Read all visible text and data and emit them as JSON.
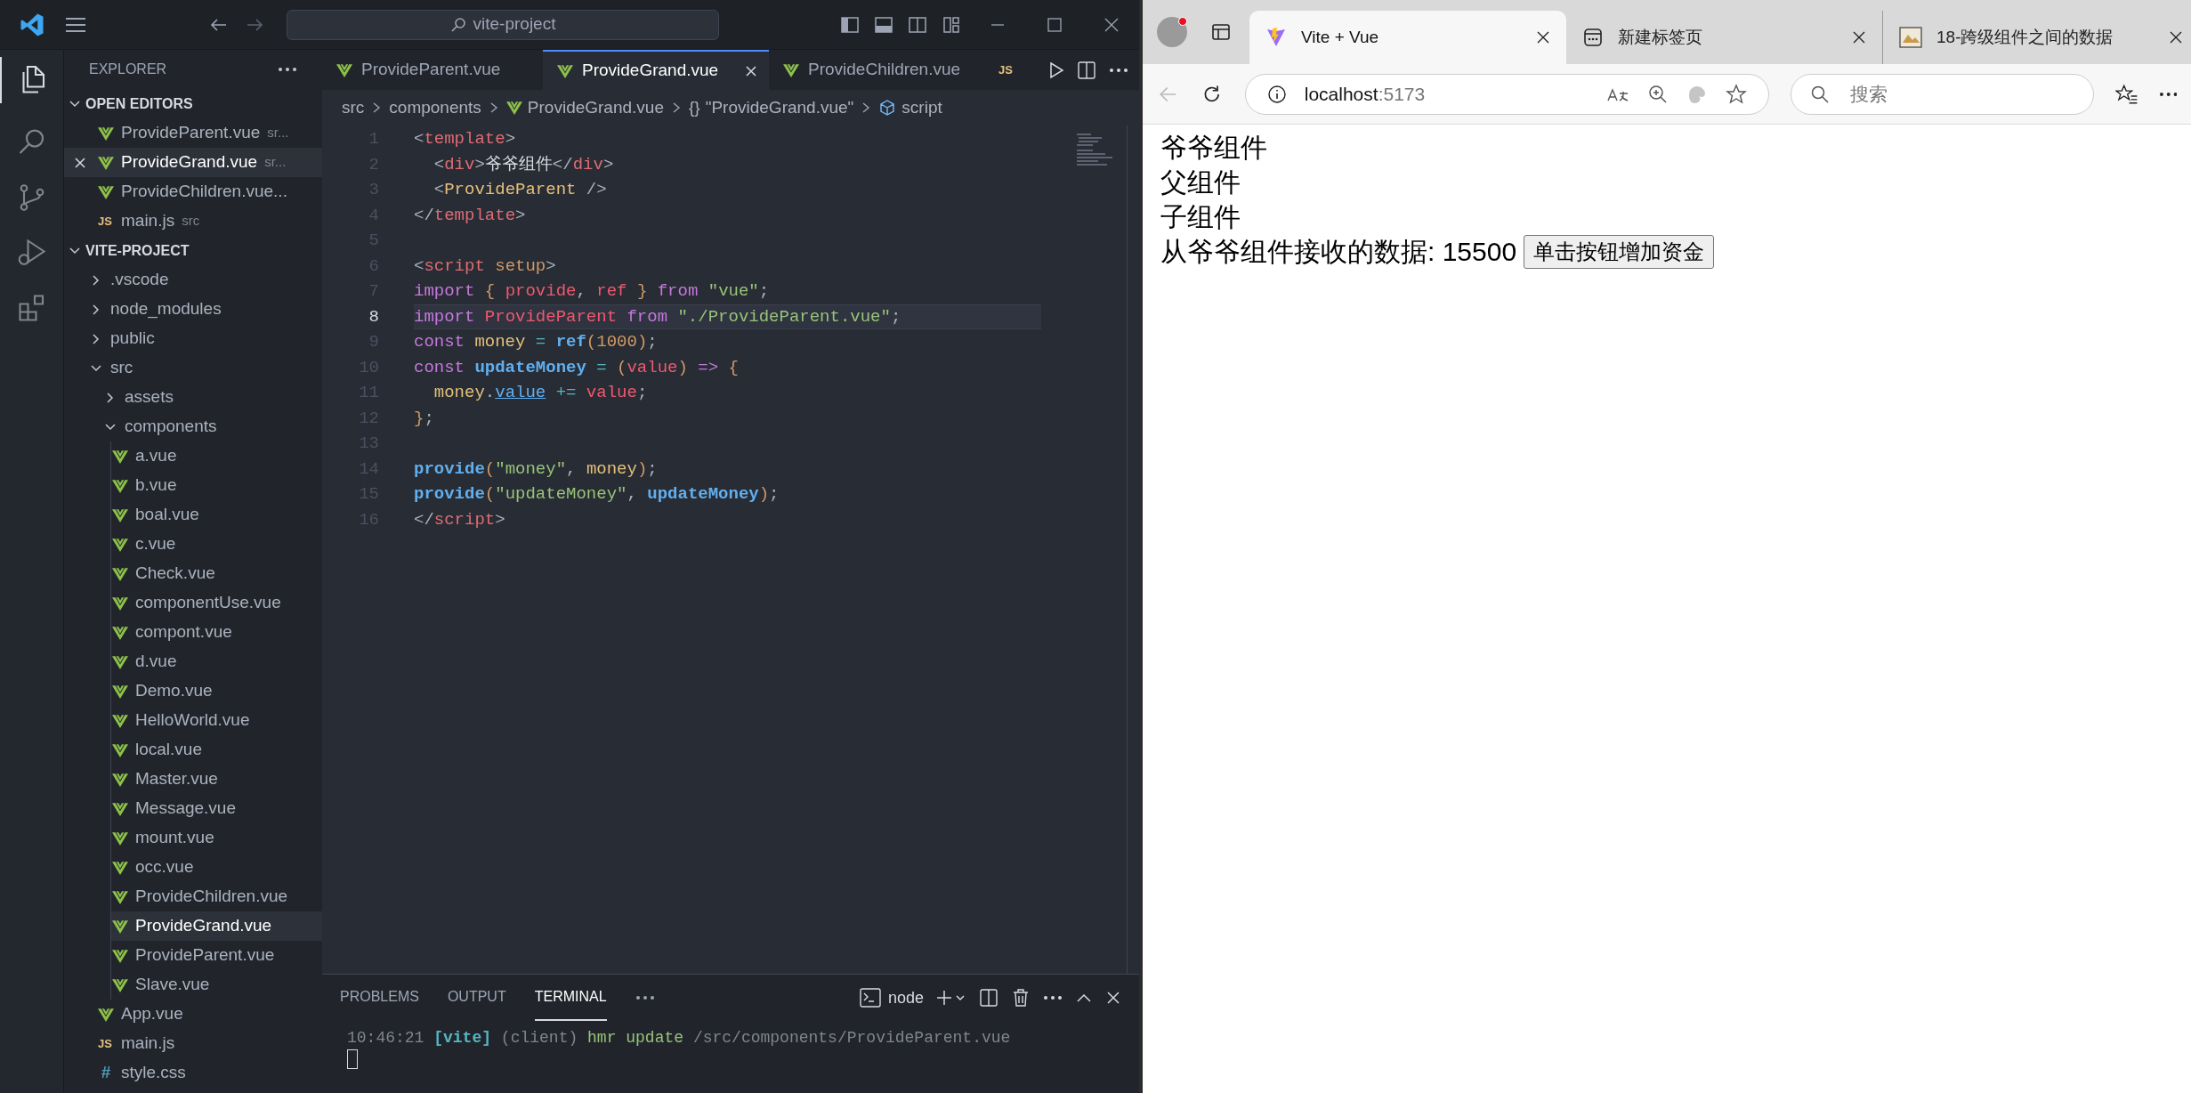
{
  "editor_window": {
    "command_center": "vite-project",
    "explorer": {
      "title": "EXPLORER",
      "open_editors": {
        "title": "OPEN EDITORS",
        "expanded": true,
        "items": [
          {
            "name": "ProvideParent.vue",
            "description": "sr...",
            "kind": "vue",
            "selected": false
          },
          {
            "name": "ProvideGrand.vue",
            "description": "sr...",
            "kind": "vue",
            "selected": true
          },
          {
            "name": "ProvideChildren.vue...",
            "kind": "vue",
            "selected": false
          },
          {
            "name": "main.js",
            "description": "src",
            "kind": "js",
            "icon": "JS",
            "selected": false
          }
        ]
      },
      "project": {
        "title": "VITE-PROJECT",
        "expanded": true,
        "items": [
          {
            "name": ".vscode",
            "kind": "folder",
            "expanded": false
          },
          {
            "name": "node_modules",
            "kind": "folder",
            "expanded": false
          },
          {
            "name": "public",
            "kind": "folder",
            "expanded": false
          },
          {
            "name": "src",
            "kind": "folder",
            "expanded": true,
            "children": [
              {
                "name": "assets",
                "kind": "folder",
                "expanded": false
              },
              {
                "name": "components",
                "kind": "folder",
                "expanded": true,
                "children": [
                  {
                    "name": "a.vue",
                    "kind": "vue",
                    "selected": false
                  },
                  {
                    "name": "b.vue",
                    "kind": "vue",
                    "selected": false
                  },
                  {
                    "name": "boal.vue",
                    "kind": "vue",
                    "selected": false
                  },
                  {
                    "name": "c.vue",
                    "kind": "vue",
                    "selected": false
                  },
                  {
                    "name": "Check.vue",
                    "kind": "vue",
                    "selected": false
                  },
                  {
                    "name": "componentUse.vue",
                    "kind": "vue",
                    "selected": false
                  },
                  {
                    "name": "compont.vue",
                    "kind": "vue",
                    "selected": false
                  },
                  {
                    "name": "d.vue",
                    "kind": "vue",
                    "selected": false
                  },
                  {
                    "name": "Demo.vue",
                    "kind": "vue",
                    "selected": false
                  },
                  {
                    "name": "HelloWorld.vue",
                    "kind": "vue",
                    "selected": false
                  },
                  {
                    "name": "local.vue",
                    "kind": "vue",
                    "selected": false
                  },
                  {
                    "name": "Master.vue",
                    "kind": "vue",
                    "selected": false
                  },
                  {
                    "name": "Message.vue",
                    "kind": "vue",
                    "selected": false
                  },
                  {
                    "name": "mount.vue",
                    "kind": "vue",
                    "selected": false
                  },
                  {
                    "name": "occ.vue",
                    "kind": "vue",
                    "selected": false
                  },
                  {
                    "name": "ProvideChildren.vue",
                    "kind": "vue",
                    "selected": false
                  },
                  {
                    "name": "ProvideGrand.vue",
                    "kind": "vue",
                    "selected": true
                  },
                  {
                    "name": "ProvideParent.vue",
                    "kind": "vue",
                    "selected": false
                  },
                  {
                    "name": "Slave.vue",
                    "kind": "vue",
                    "selected": false
                  }
                ]
              },
              {
                "name": "App.vue",
                "kind": "vue",
                "selected": false
              },
              {
                "name": "main.js",
                "kind": "js",
                "icon": "JS",
                "selected": false
              },
              {
                "name": "style.css",
                "kind": "css",
                "icon": "#",
                "selected": false
              }
            ]
          }
        ]
      }
    },
    "tabs": [
      {
        "label": "ProvideParent.vue",
        "kind": "vue",
        "selected": false
      },
      {
        "label": "ProvideGrand.vue",
        "kind": "vue",
        "selected": true
      },
      {
        "label": "ProvideChildren.vue",
        "kind": "vue",
        "selected": false
      },
      {
        "label": "JS",
        "kind": "js-icon",
        "selected": false
      }
    ],
    "breadcrumb": [
      {
        "text": "src",
        "kind": "plain"
      },
      {
        "text": "components",
        "kind": "plain"
      },
      {
        "text": "ProvideGrand.vue",
        "kind": "vue"
      },
      {
        "text": "\"ProvideGrand.vue\"",
        "kind": "braces",
        "icon": "{}"
      },
      {
        "text": "script",
        "kind": "cube"
      }
    ],
    "code": [
      {
        "number": "1",
        "active": false,
        "tokens": [
          {
            "text": "<",
            "kind": "p"
          },
          {
            "text": "template",
            "kind": "tag"
          },
          {
            "text": ">",
            "kind": "p"
          }
        ]
      },
      {
        "number": "2",
        "active": false,
        "tokens": [
          {
            "text": "  <",
            "kind": "p"
          },
          {
            "text": "div",
            "kind": "tag"
          },
          {
            "text": ">",
            "kind": "p"
          },
          {
            "text": "爷爷组件",
            "kind": "text"
          },
          {
            "text": "</",
            "kind": "p"
          },
          {
            "text": "div",
            "kind": "tag"
          },
          {
            "text": ">",
            "kind": "p"
          }
        ]
      },
      {
        "number": "3",
        "active": false,
        "tokens": [
          {
            "text": "  <",
            "kind": "p"
          },
          {
            "text": "ProvideParent",
            "kind": "comp"
          },
          {
            "text": " />",
            "kind": "p"
          }
        ]
      },
      {
        "number": "4",
        "active": false,
        "tokens": [
          {
            "text": "</",
            "kind": "p"
          },
          {
            "text": "template",
            "kind": "tag"
          },
          {
            "text": ">",
            "kind": "p"
          }
        ]
      },
      {
        "number": "5",
        "active": false
      },
      {
        "number": "6",
        "active": false,
        "tokens": [
          {
            "text": "<",
            "kind": "p"
          },
          {
            "text": "script",
            "kind": "tag"
          },
          {
            "text": " setup",
            "kind": "attr"
          },
          {
            "text": ">",
            "kind": "p"
          }
        ]
      },
      {
        "number": "7",
        "active": false,
        "tokens": [
          {
            "text": "import",
            "kind": "kw"
          },
          {
            "text": " { ",
            "kind": "brace"
          },
          {
            "text": "provide",
            "kind": "id"
          },
          {
            "text": ", ",
            "kind": "p"
          },
          {
            "text": "ref",
            "kind": "id"
          },
          {
            "text": " } ",
            "kind": "brace"
          },
          {
            "text": "from",
            "kind": "kw"
          },
          {
            "text": " \"vue\"",
            "kind": "str"
          },
          {
            "text": ";",
            "kind": "p"
          }
        ]
      },
      {
        "number": "8",
        "active": true,
        "tokens": [
          {
            "text": "import",
            "kind": "kw"
          },
          {
            "text": " ProvideParent ",
            "kind": "id"
          },
          {
            "text": "from",
            "kind": "kw"
          },
          {
            "text": " \"./ProvideParent.vue\"",
            "kind": "str"
          },
          {
            "text": ";",
            "kind": "p"
          }
        ]
      },
      {
        "number": "9",
        "active": false,
        "tokens": [
          {
            "text": "const",
            "kind": "kw"
          },
          {
            "text": " money ",
            "kind": "var"
          },
          {
            "text": "=",
            "kind": "op"
          },
          {
            "text": " ref",
            "kind": "fn"
          },
          {
            "text": "(",
            "kind": "brace"
          },
          {
            "text": "1000",
            "kind": "num"
          },
          {
            "text": ")",
            "kind": "brace"
          },
          {
            "text": ";",
            "kind": "p"
          }
        ]
      },
      {
        "number": "10",
        "active": false,
        "tokens": [
          {
            "text": "const",
            "kind": "kw"
          },
          {
            "text": " updateMoney ",
            "kind": "fn"
          },
          {
            "text": "=",
            "kind": "op"
          },
          {
            "text": " (",
            "kind": "brace"
          },
          {
            "text": "value",
            "kind": "id"
          },
          {
            "text": ") ",
            "kind": "brace"
          },
          {
            "text": "=>",
            "kind": "kw"
          },
          {
            "text": " {",
            "kind": "brace"
          }
        ]
      },
      {
        "number": "11",
        "active": false,
        "tokens": [
          {
            "text": "  money",
            "kind": "var"
          },
          {
            "text": ".",
            "kind": "p"
          },
          {
            "text": "value",
            "kind": "link"
          },
          {
            "text": " += ",
            "kind": "op"
          },
          {
            "text": "value",
            "kind": "id"
          },
          {
            "text": ";",
            "kind": "p"
          }
        ]
      },
      {
        "number": "12",
        "active": false,
        "tokens": [
          {
            "text": "}",
            "kind": "brace"
          },
          {
            "text": ";",
            "kind": "p"
          }
        ]
      },
      {
        "number": "13",
        "active": false
      },
      {
        "number": "14",
        "active": false,
        "tokens": [
          {
            "text": "provide",
            "kind": "fn"
          },
          {
            "text": "(",
            "kind": "brace"
          },
          {
            "text": "\"money\"",
            "kind": "str"
          },
          {
            "text": ", ",
            "kind": "p"
          },
          {
            "text": "money",
            "kind": "var"
          },
          {
            "text": ")",
            "kind": "brace"
          },
          {
            "text": ";",
            "kind": "p"
          }
        ]
      },
      {
        "number": "15",
        "active": false,
        "tokens": [
          {
            "text": "provide",
            "kind": "fn"
          },
          {
            "text": "(",
            "kind": "brace"
          },
          {
            "text": "\"updateMoney\"",
            "kind": "str"
          },
          {
            "text": ", ",
            "kind": "p"
          },
          {
            "text": "updateMoney",
            "kind": "fn"
          },
          {
            "text": ")",
            "kind": "brace"
          },
          {
            "text": ";",
            "kind": "p"
          }
        ]
      },
      {
        "number": "16",
        "active": false,
        "tokens": [
          {
            "text": "</",
            "kind": "p"
          },
          {
            "text": "script",
            "kind": "tag"
          },
          {
            "text": ">",
            "kind": "p"
          }
        ]
      }
    ],
    "panel": {
      "tabs": [
        {
          "label": "PROBLEMS",
          "selected": false
        },
        {
          "label": "OUTPUT",
          "selected": false
        },
        {
          "label": "TERMINAL",
          "selected": true
        }
      ],
      "terminal_name": "node",
      "terminal_lines": [
        {
          "tokens": [
            {
              "text": "10:46:21 ",
              "kind": "dim"
            },
            {
              "text": "[vite]",
              "kind": "vite"
            },
            {
              "text": " (client) ",
              "kind": "dim"
            },
            {
              "text": "hmr update",
              "kind": "green"
            },
            {
              "text": " /src/components/ProvideParent.vue",
              "kind": "dim"
            }
          ]
        }
      ]
    }
  },
  "browser": {
    "tabs": [
      {
        "title": "Vite + Vue",
        "kind": "vite",
        "selected": true
      },
      {
        "title": "新建标签页",
        "kind": "newtab",
        "selected": false
      },
      {
        "title": "18-跨级组件之间的数据",
        "kind": "image",
        "selected": false
      }
    ],
    "address": {
      "host": "localhost",
      "port": ":5173"
    },
    "search": {
      "placeholder": "搜索"
    },
    "page": {
      "lines": [
        "爷爷组件",
        "父组件",
        "子组件"
      ],
      "data_label": "从爷爷组件接收的数据: 15500",
      "button": "单击按钮增加资金"
    }
  }
}
